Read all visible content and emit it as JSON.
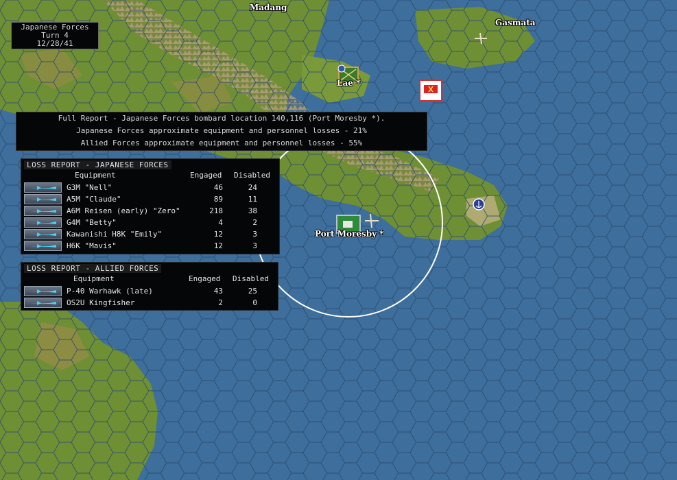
{
  "colors": {
    "sea": "#3d6e9c",
    "land": "#7a9a3a",
    "mountain": "#8a7a5a",
    "panel": "#050608"
  },
  "turn_box": {
    "side": "Japanese Forces",
    "turn": "Turn 4",
    "date": "12/28/41"
  },
  "map_labels": {
    "madang": "Madang",
    "gasmata": "Gasmata",
    "lae": "Lae *",
    "port_moresby": "Port Moresby *"
  },
  "report": {
    "line1": "Full Report -  Japanese Forces bombard location 140,116 (Port Moresby *).",
    "line2": "Japanese Forces approximate equipment and personnel losses - 21%",
    "line3": "Allied Forces approximate equipment and personnel losses - 55%"
  },
  "loss_japanese": {
    "title": "LOSS REPORT -  JAPANESE FORCES",
    "col_equipment": "Equipment",
    "col_engaged": "Engaged",
    "col_disabled": "Disabled",
    "rows": [
      {
        "name": "G3M \"Nell\"",
        "engaged": "46",
        "disabled": "24"
      },
      {
        "name": "A5M \"Claude\"",
        "engaged": "89",
        "disabled": "11"
      },
      {
        "name": "A6M Reisen (early) \"Zero\"",
        "engaged": "218",
        "disabled": "38"
      },
      {
        "name": "G4M \"Betty\"",
        "engaged": "4",
        "disabled": "2"
      },
      {
        "name": "Kawanishi H8K \"Emily\"",
        "engaged": "12",
        "disabled": "3"
      },
      {
        "name": "H6K \"Mavis\"",
        "engaged": "12",
        "disabled": "3"
      }
    ]
  },
  "loss_allied": {
    "title": "LOSS REPORT -  ALLIED FORCES",
    "col_equipment": "Equipment",
    "col_engaged": "Engaged",
    "col_disabled": "Disabled",
    "rows": [
      {
        "name": "P-40 Warhawk (late)",
        "engaged": "43",
        "disabled": "25"
      },
      {
        "name": "OS2U Kingfisher",
        "engaged": "2",
        "disabled": "0"
      }
    ]
  }
}
